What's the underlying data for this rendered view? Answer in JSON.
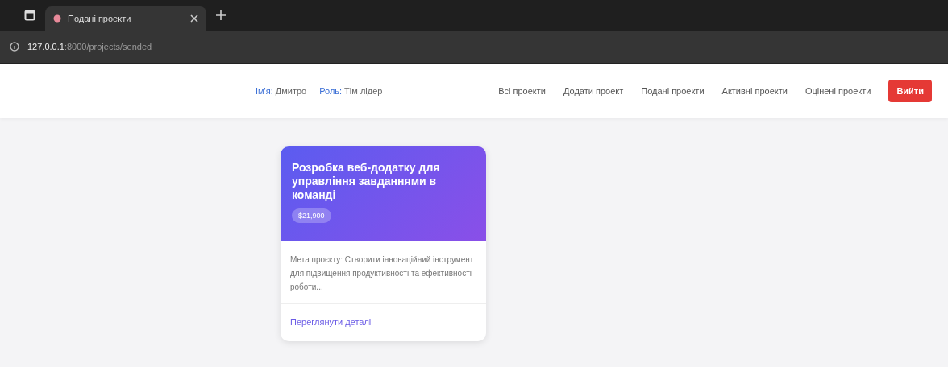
{
  "browser": {
    "tab": {
      "title": "Подані проекти"
    },
    "url": {
      "host": "127.0.0.1",
      "path": ":8000/projects/sended"
    }
  },
  "header": {
    "user": {
      "label": "Ім'я:",
      "value": "Дмитро"
    },
    "role": {
      "label": "Роль:",
      "value": "Тім лідер"
    },
    "nav": [
      "Всі проекти",
      "Додати проект",
      "Подані проекти",
      "Активні проекти",
      "Оцінені проекти"
    ],
    "logout": "Вийти"
  },
  "projects": [
    {
      "title": "Розробка веб-додатку для управління завданнями в команді",
      "budget": "$21,900",
      "description": "Мета проєкту: Створити інноваційний інструмент для підвищення продуктивності та ефективності роботи...",
      "link": "Переглянути деталі"
    }
  ]
}
